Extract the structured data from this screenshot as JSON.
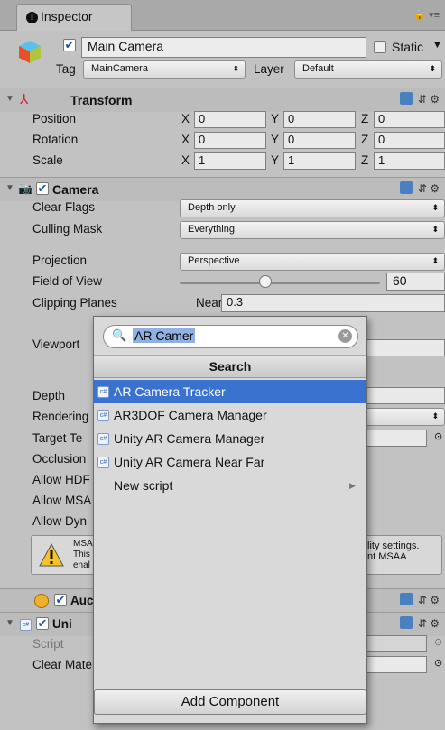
{
  "tab": {
    "title": "Inspector"
  },
  "object": {
    "name": "Main Camera",
    "static_label": "Static",
    "tag_label": "Tag",
    "tag_value": "MainCamera",
    "layer_label": "Layer",
    "layer_value": "Default"
  },
  "transform": {
    "title": "Transform",
    "axes": [
      "X",
      "Y",
      "Z"
    ],
    "rows": [
      {
        "label": "Position",
        "x": "0",
        "y": "0",
        "z": "0"
      },
      {
        "label": "Rotation",
        "x": "0",
        "y": "0",
        "z": "0"
      },
      {
        "label": "Scale",
        "x": "1",
        "y": "1",
        "z": "1"
      }
    ]
  },
  "camera": {
    "title": "Camera",
    "clear_flags_label": "Clear Flags",
    "clear_flags_value": "Depth only",
    "culling_mask_label": "Culling Mask",
    "culling_mask_value": "Everything",
    "projection_label": "Projection",
    "projection_value": "Perspective",
    "fov_label": "Field of View",
    "fov_value": "60",
    "fov_fraction": 0.43,
    "clipping_label": "Clipping Planes",
    "near_label": "Near",
    "near_value": "0.3",
    "viewport_label": "Viewport",
    "depth_label": "Depth",
    "rendering_label": "Rendering",
    "target_label": "Target Te",
    "occlusion_label": "Occlusion",
    "hdr_label": "Allow HDF",
    "msaa_label": "Allow MSA",
    "dyn_label": "Allow Dyn",
    "warning": {
      "left": [
        "MSA",
        "This",
        "enal"
      ],
      "right": [
        "lity settings.",
        "nt MSAA"
      ]
    }
  },
  "audio": {
    "title": "Auc"
  },
  "unity_component": {
    "title": "Uni",
    "script_label": "Script",
    "clear_label": "Clear Mate"
  },
  "popup": {
    "query": "AR Camer",
    "header": "Search",
    "items": [
      "AR Camera Tracker",
      "AR3DOF Camera Manager",
      "Unity AR Camera Manager",
      "Unity AR Camera Near Far",
      "New script"
    ],
    "icon_text": "c#",
    "add_component": "Add Component"
  },
  "colors": {
    "selection": "#3a72d0",
    "panel": "#c2c2c2"
  }
}
